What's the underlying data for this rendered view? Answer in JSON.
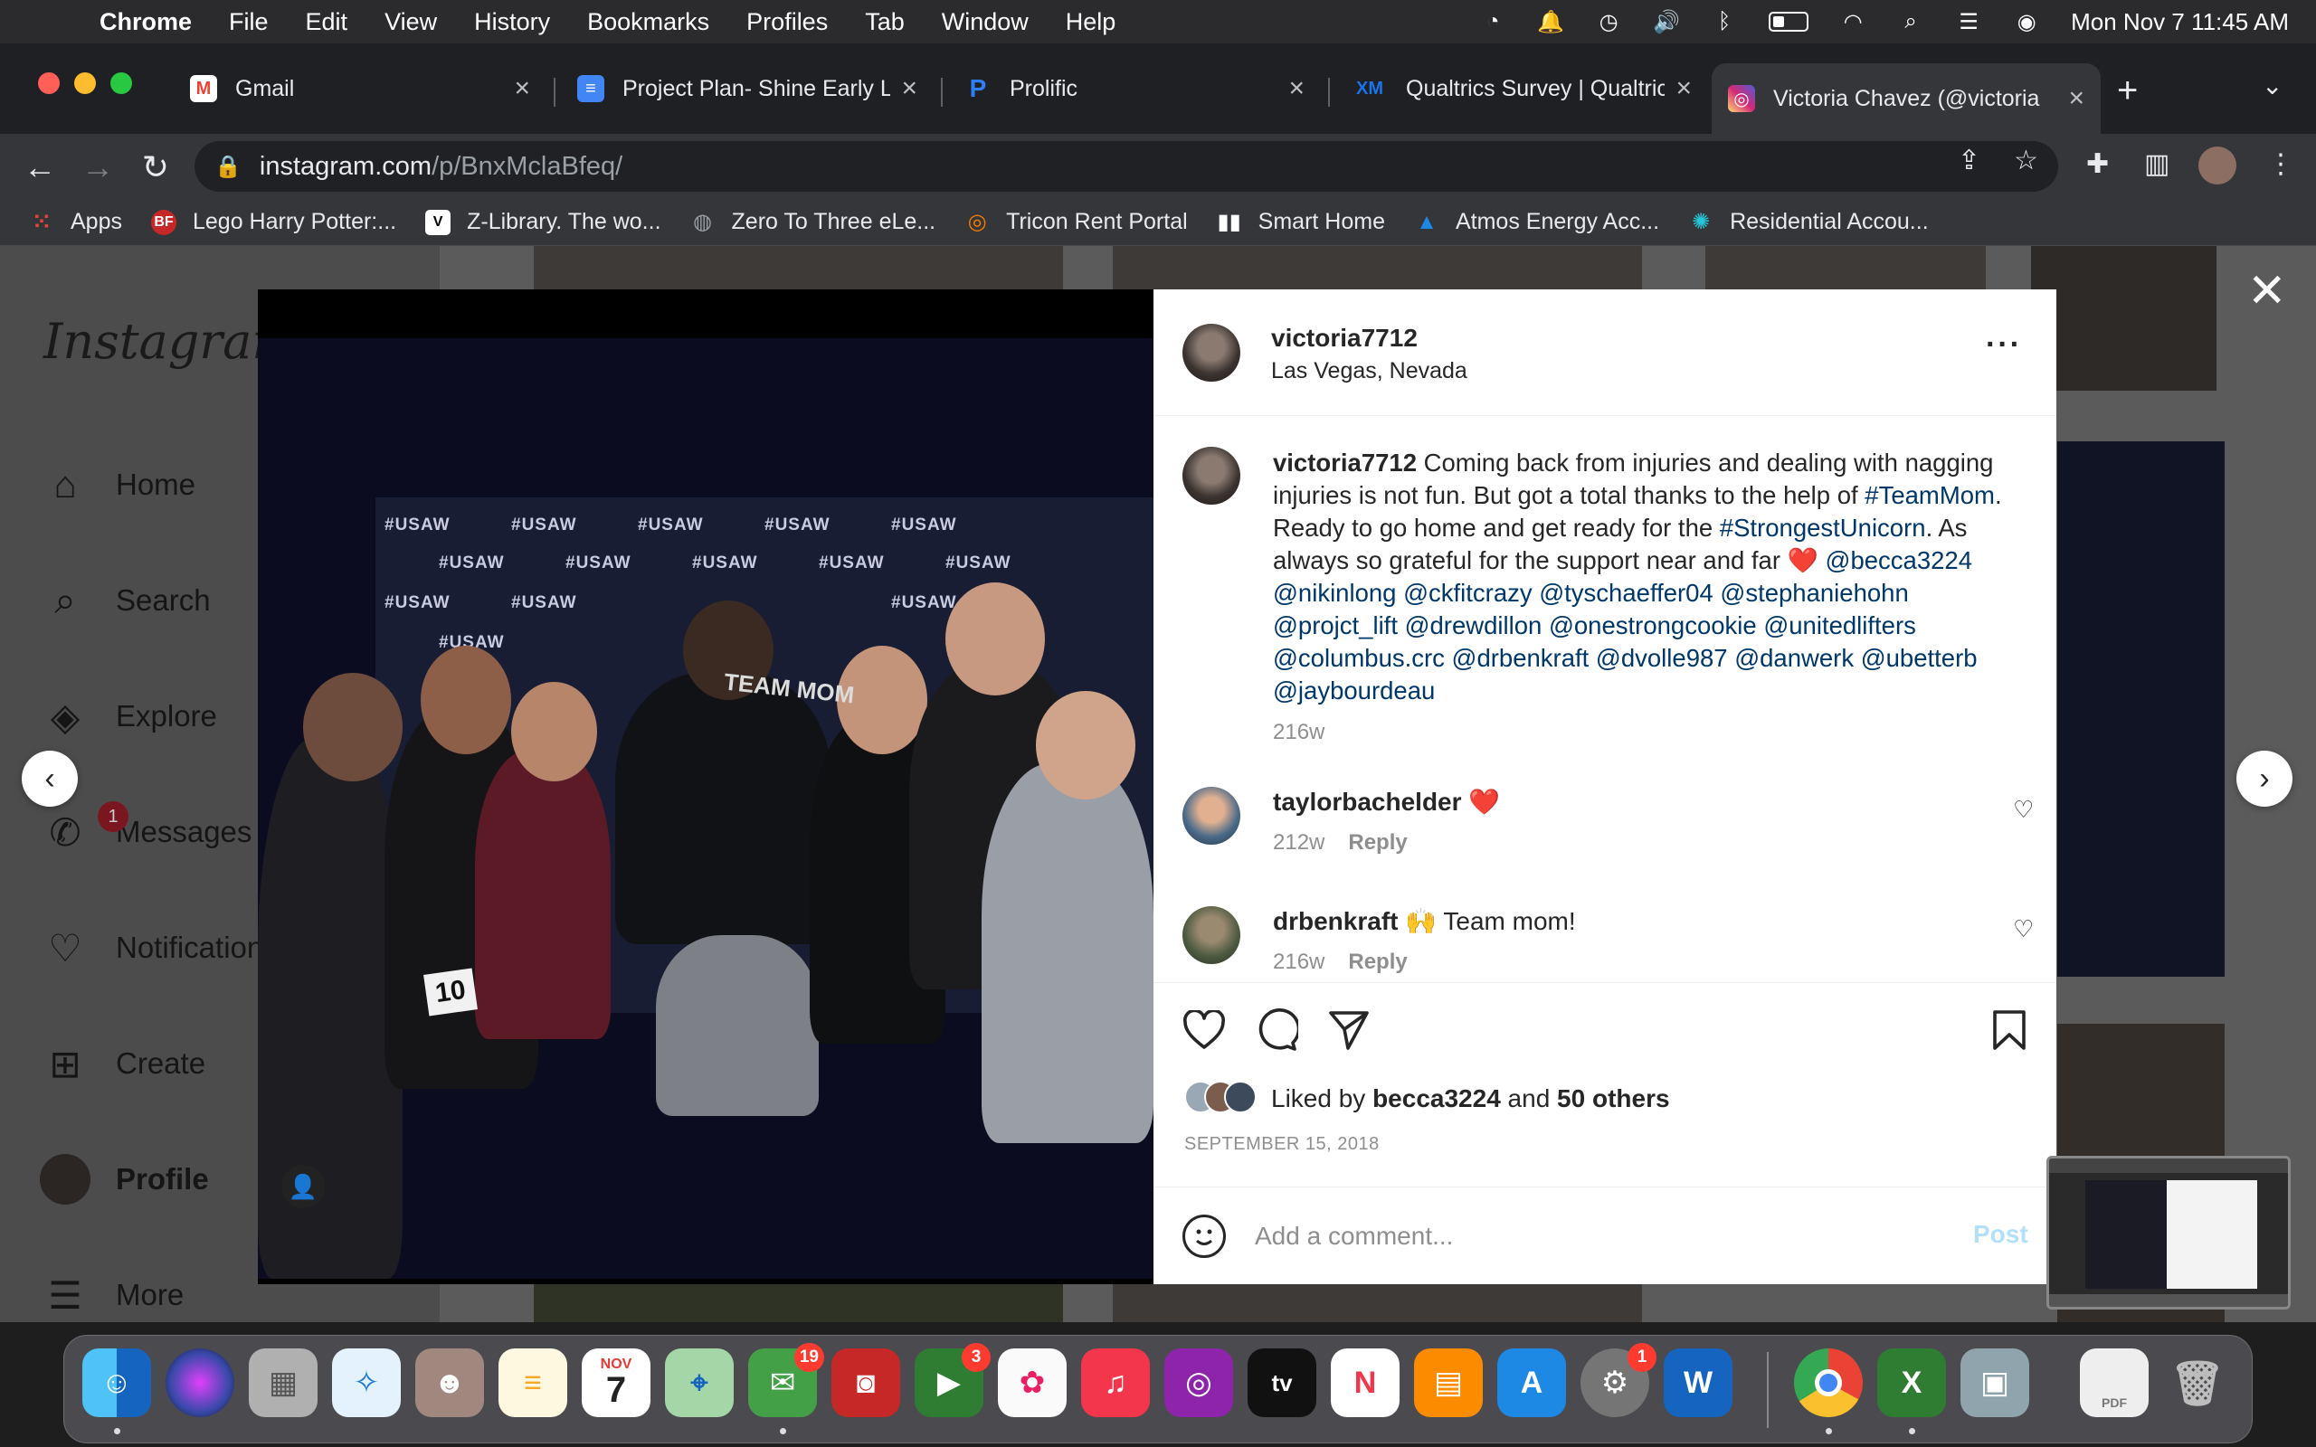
{
  "menubar": {
    "app_name": "Chrome",
    "menus": [
      "File",
      "Edit",
      "View",
      "History",
      "Bookmarks",
      "Profiles",
      "Tab",
      "Window",
      "Help"
    ],
    "datetime": "Mon Nov 7  11:45 AM"
  },
  "tabs": [
    {
      "title": "Gmail",
      "icon": "gmail-icon",
      "fav": "M",
      "color": "#ea4335"
    },
    {
      "title": "Project Plan- Shine Early L",
      "icon": "docs-icon",
      "fav": "≡",
      "color": "#4285f4"
    },
    {
      "title": "Prolific",
      "icon": "prolific-icon",
      "fav": "P",
      "color": "#2d7ff9"
    },
    {
      "title": "Qualtrics Survey | Qualtric",
      "icon": "qualtrics-icon",
      "fav": "XM",
      "color": "#1a73e8"
    },
    {
      "title": "Victoria Chavez (@victoria",
      "icon": "instagram-icon",
      "fav": "◎",
      "color": "#d6249f"
    }
  ],
  "address": {
    "host": "instagram.com",
    "path": "/p/BnxMclaBfeq/"
  },
  "bookmarks": [
    {
      "label": "Apps",
      "icon": "apps-grid-icon",
      "color": "#ea4335"
    },
    {
      "label": "Lego Harry Potter:...",
      "icon": "bf-icon",
      "color": "#c62828"
    },
    {
      "label": "Z-Library. The wo...",
      "icon": "zlib-icon",
      "color": "#ffffff"
    },
    {
      "label": "Zero To Three eLe...",
      "icon": "globe-icon",
      "color": "#9aa0a6"
    },
    {
      "label": "Tricon Rent Portal",
      "icon": "tricon-icon",
      "color": "#f57c00"
    },
    {
      "label": "Smart Home",
      "icon": "bars-icon",
      "color": "#ffffff"
    },
    {
      "label": "Atmos Energy Acc...",
      "icon": "atmos-icon",
      "color": "#1565c0"
    },
    {
      "label": "Residential Accou...",
      "icon": "spark-icon",
      "color": "#26c6da"
    }
  ],
  "instagram": {
    "logo": "Instagram",
    "nav": [
      {
        "label": "Home",
        "icon": "home-icon"
      },
      {
        "label": "Search",
        "icon": "search-icon"
      },
      {
        "label": "Explore",
        "icon": "compass-icon"
      },
      {
        "label": "Messages",
        "icon": "messenger-icon",
        "badge": "1"
      },
      {
        "label": "Notifications",
        "icon": "heart-icon"
      },
      {
        "label": "Create",
        "icon": "plus-square-icon"
      },
      {
        "label": "Profile",
        "icon": "profile-avatar-icon"
      },
      {
        "label": "More",
        "icon": "hamburger-icon"
      }
    ]
  },
  "photo": {
    "backdrop_text": "#USAW",
    "shirt_text": "TEAM MOM",
    "bib_number": "10"
  },
  "post": {
    "username": "victoria7712",
    "location": "Las Vegas, Nevada",
    "caption_parts": [
      {
        "text": "Coming back from injuries and dealing with nagging injuries is not fun. But got a total thanks to the help of ",
        "tag": false
      },
      {
        "text": "#TeamMom",
        "tag": true
      },
      {
        "text": ". Ready to go home and get ready for the ",
        "tag": false
      },
      {
        "text": "#StrongestUnicorn",
        "tag": true
      },
      {
        "text": ". As always so grateful for the support near and far ❤️ ",
        "tag": false
      },
      {
        "text": "@becca3224 @nikinlong @ckfitcrazy @tyschaeffer04 @stephaniehohn @projct_lift @drewdillon @onestrongcookie @unitedlifters @columbus.crc @drbenkraft @dvolle987 @danwerk @ubetterb @jaybourdeau",
        "tag": true
      }
    ],
    "caption_age": "216w",
    "comments": [
      {
        "username": "taylorbachelder",
        "text": "❤️",
        "age": "212w",
        "reply": "Reply"
      },
      {
        "username": "drbenkraft",
        "text": "🙌 Team mom!",
        "age": "216w",
        "reply": "Reply"
      }
    ],
    "liked_by_prefix": "Liked by",
    "liked_by_user": "becca3224",
    "liked_by_and": "and",
    "liked_by_others": "50 others",
    "date": "SEPTEMBER 15, 2018",
    "comment_placeholder": "Add a comment...",
    "post_label": "Post"
  },
  "dock": {
    "apps": [
      {
        "name": "finder-icon",
        "glyph": "☺",
        "color": "#1e88e5"
      },
      {
        "name": "siri-icon",
        "glyph": "◉",
        "color": "#6a1b9a"
      },
      {
        "name": "launchpad-icon",
        "glyph": "▦",
        "color": "#9e9e9e"
      },
      {
        "name": "safari-icon",
        "glyph": "✧",
        "color": "#1976d2"
      },
      {
        "name": "contacts-icon",
        "glyph": "☻",
        "color": "#a1887f"
      },
      {
        "name": "notes-icon",
        "glyph": "≡",
        "color": "#fdd835"
      },
      {
        "name": "calendar-icon",
        "glyph": "7",
        "color": "#ffffff"
      },
      {
        "name": "maps-icon",
        "glyph": "⌖",
        "color": "#66bb6a"
      },
      {
        "name": "messages-icon",
        "glyph": "✉",
        "color": "#43a047",
        "badge": "19"
      },
      {
        "name": "photo-booth-icon",
        "glyph": "◙",
        "color": "#c62828"
      },
      {
        "name": "facetime-icon",
        "glyph": "▶",
        "color": "#2e7d32",
        "badge": "3"
      },
      {
        "name": "photos-icon",
        "glyph": "✿",
        "color": "#f5f5f5"
      },
      {
        "name": "music-icon",
        "glyph": "♫",
        "color": "#f4364c"
      },
      {
        "name": "podcasts-icon",
        "glyph": "◎",
        "color": "#8e24aa"
      },
      {
        "name": "apple-tv-icon",
        "glyph": "tv",
        "color": "#111111"
      },
      {
        "name": "news-icon",
        "glyph": "N",
        "color": "#ffffff"
      },
      {
        "name": "books-icon",
        "glyph": "▤",
        "color": "#fb8c00"
      },
      {
        "name": "app-store-icon",
        "glyph": "A",
        "color": "#1e88e5"
      },
      {
        "name": "system-preferences-icon",
        "glyph": "⚙",
        "color": "#757575",
        "badge": "1"
      },
      {
        "name": "word-icon",
        "glyph": "W",
        "color": "#1565c0"
      },
      {
        "name": "chrome-icon",
        "glyph": "◉",
        "color": "#fbc02d"
      },
      {
        "name": "excel-icon",
        "glyph": "X",
        "color": "#2e7d32"
      },
      {
        "name": "preview-icon",
        "glyph": "▣",
        "color": "#90a4ae"
      },
      {
        "name": "pdf-document-icon",
        "glyph": "▯",
        "color": "#eeeeee"
      },
      {
        "name": "trash-icon",
        "glyph": "🗑",
        "color": "#9e9e9e"
      }
    ],
    "calendar_month": "NOV",
    "calendar_day": "7",
    "pdf_label": "PDF"
  }
}
